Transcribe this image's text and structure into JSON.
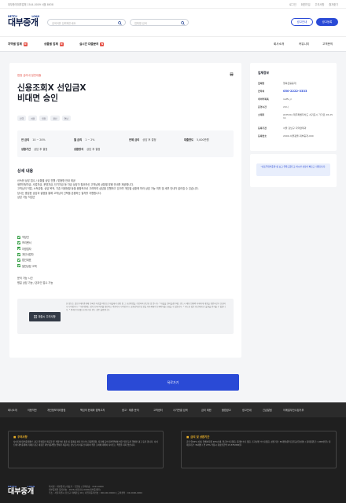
{
  "topbar": {
    "left_text": "대부중개대부업체 1544-0009 서울 8638",
    "links": [
      "로그인",
      "회원가입",
      "주의사항",
      "즐겨찾기"
    ]
  },
  "header": {
    "logo_sub_left": "NETFU",
    "logo_sub_right": "LOAN",
    "logo_main": "대부중개",
    "search1_placeholder": "검색어를 입력해주세요",
    "search2_placeholder": "업체명 검색",
    "ad_button": "광고안내",
    "register_button": "광고등록"
  },
  "nav": {
    "items": [
      {
        "label": "지역별 업체",
        "badge": "N"
      },
      {
        "label": "상품별 업체",
        "badge": "N"
      },
      {
        "label": "실시간 대출문의",
        "badge": "N"
      }
    ],
    "right_items": [
      "회사소개",
      "커뮤니티",
      "고객문의"
    ]
  },
  "listing": {
    "category": "법정 금리내 일반대출",
    "title_line1": "신용조회X 선입금X",
    "title_line2": "비대면 승인",
    "tags": [
      "전국",
      "서울",
      "인천",
      "울산",
      "연남"
    ],
    "spec": {
      "rate_label": "연 금리",
      "rate_value": "10 ~ 20%",
      "monthly_label": "월 금리",
      "monthly_value": "1 ~ 2%",
      "overdue_label": "연체 금리",
      "overdue_value": "상담 후 결정",
      "amount_label": "대출한도",
      "amount_value": "5,000만원",
      "repay_label": "상환기간",
      "repay_value": "상담 후 결정",
      "method_label": "상환방식",
      "method_value": "상담 후 결정"
    },
    "detail_title": "상세 내용",
    "detail_lines": [
      "신속한 상담 접수 / 상황별 상담 진행 / 맞춤형 안내 제공",
      "생활안정자금, 사업자금, 운영자금, 단기자금 등 자금 상담이 필요하신 고객님께 상황별 맞춤 안내를 제공합니다.",
      "고객님의 직업, 소득유형, 상담 목적, 기존 이용현황 등을 종합적으로 고려하여 상담을 진행하고 있으며 개인별 상황에 따라 상담 가능 여부 및 세부 안내가 달라질 수 있습니다.",
      "당사는 충분한 상담과 설명을 통해 고객님의 선택을 존중하는 절차를 지향합니다.",
      "상담 가능 직업군"
    ],
    "checks": [
      "직장인",
      "프리랜서",
      "자영업자",
      "개인사업자",
      "법인대표",
      "일반상담 고객"
    ],
    "extra_lines": [
      "문의 가능 시간",
      "평일 상담 가능 / 온라인 접수 가능"
    ],
    "notice_label": "대출시 주의사항",
    "notice_text": "본 정보는 넷프루대부중개에 등록된 자료를 바탕으로 대출에서 현장 및 그 표현방법을 수정하며 판단한 것 입니다. * 대출을 원하실경우에는 반드시 해당 업체와 자세하게 내용을 확인하신후 신청하시기 바랍니다. * 대부업체는 정식 등록 여부를 확인하고 이용하시기 바랍니다. 금융감독원 및 관할 지자체에서 등록여부를 조회할 수 있습니다. * 과도한 빚은 당신에게 큰 불행을 안겨줄 수 있습니다. * 중개수수료를 요구하거나 받는 것은 불법입니다."
  },
  "company": {
    "section_title": "업체정보",
    "rows": [
      {
        "k": "업체명",
        "v": "행복금융중개"
      },
      {
        "k": "연락처",
        "v": "050-2222-3333"
      },
      {
        "k": "네이버톡톡",
        "v": "netfu_n"
      },
      {
        "k": "운영시간",
        "v": "24시"
      },
      {
        "k": "소재지",
        "v": "(63534) 제주특별자치도 서귀포시 가가로 28-25 11"
      },
      {
        "k": "등록기관",
        "v": "서울 강남구 지역경제과"
      },
      {
        "k": "등록번호",
        "v": "2000-서울광울-대부중개-000"
      }
    ],
    "banner_text": "\"넷프루대부중개\"를 보고 연락드렸다고 하시면 상담이 빠르고 쉬워집니다."
  },
  "back_button": "뒤로가기",
  "footer_nav": [
    "회사소개",
    "이용약관",
    "개인정보처리방침",
    "책임의 한계와 법적고지",
    "광고 · 제휴 문의",
    "고객센터",
    "사기판결 검색",
    "금리 제한",
    "불법광고",
    "광고안내",
    "긴급알림",
    "이메일무단수집거부"
  ],
  "footer": {
    "warn_title": "주의사항",
    "warn_text": "사이트에 대부중개대부, 광고 플랫폼만 제공할 뿐 직접적인 대출 및 중개를 하지 않으며 금융위원회, 지자체 등의 대부업법에 의한 직접 등록 업체만 광고 등록 합니다. 사이트에 대부중개에 기재된 광고 내용은 대부(중개업) 업체가 제공하는 정보로서 이를 신뢰하여 취한 조치에 대해서 사이트는 책임을 지지 않습니다.",
    "rate_title": "금리 및 상환기간",
    "rate_text": "금리 연20% 이내, 연체이자율 20%이내, 취급수수료없음, 중개수수료 없음. 조기상환 수수료없음. 상환기간: 36개월(원리금균등분할상환) / 총대출원금: 1,000만원 / 총대출기간: 36개월 / 연 20% 적용시 총상환금액 13,378,800원.",
    "logo_sub_left": "NETFU",
    "logo_sub_right": "LOAN",
    "logo_main": "대부중개",
    "info_lines": [
      "회사명 : 대부중개 | 대표자 : 홍길동 | 전화번호 : 1544-0000",
      "대부중개업 등록번호 : 2026-서울강남-0000(대부중개업)",
      "주소 : 서울특별시 강남구 테헤란로 00 | 사업자등록번호 : 000-00-00000 | 고객센터 : 02-0000-0000"
    ]
  }
}
